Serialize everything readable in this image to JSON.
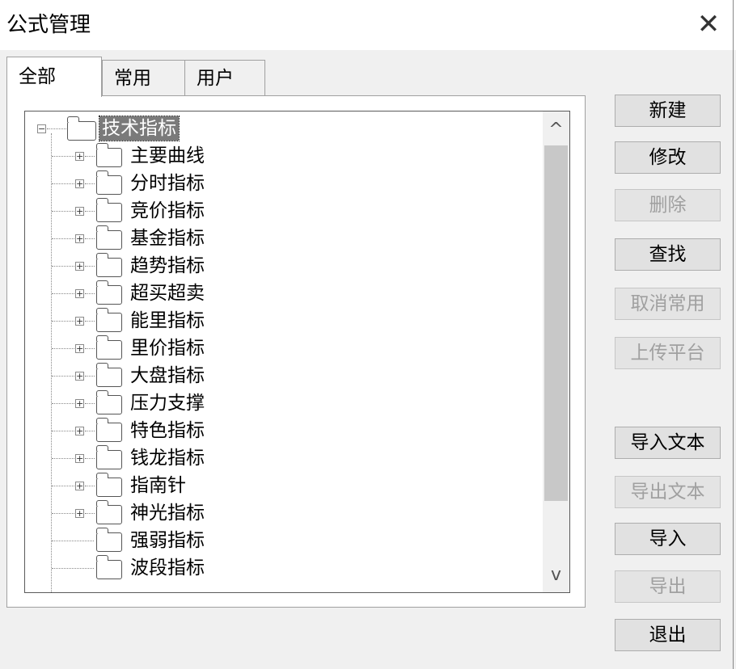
{
  "window": {
    "title": "公式管理",
    "close_label": "✕"
  },
  "tabs": [
    {
      "label": "全部",
      "active": true
    },
    {
      "label": "常用",
      "active": false
    },
    {
      "label": "用户",
      "active": false
    }
  ],
  "tree": {
    "root": {
      "label": "技术指标",
      "expander": "−"
    },
    "children": [
      {
        "label": "主要曲线",
        "expander": "+"
      },
      {
        "label": "分时指标",
        "expander": "+"
      },
      {
        "label": "竞价指标",
        "expander": "+"
      },
      {
        "label": "基金指标",
        "expander": "+"
      },
      {
        "label": "趋势指标",
        "expander": "+"
      },
      {
        "label": "超买超卖",
        "expander": "+"
      },
      {
        "label": "能里指标",
        "expander": "+"
      },
      {
        "label": "里价指标",
        "expander": "+"
      },
      {
        "label": "大盘指标",
        "expander": "+"
      },
      {
        "label": "压力支撑",
        "expander": "+"
      },
      {
        "label": "特色指标",
        "expander": "+"
      },
      {
        "label": "钱龙指标",
        "expander": "+"
      },
      {
        "label": "指南针",
        "expander": "+"
      },
      {
        "label": "神光指标",
        "expander": "+"
      },
      {
        "label": "强弱指标",
        "expander": ""
      },
      {
        "label": "波段指标",
        "expander": ""
      }
    ]
  },
  "scrollbar": {
    "up_arrow": "^",
    "down_arrow": "v"
  },
  "buttons": [
    {
      "label": "新建",
      "enabled": true
    },
    {
      "label": "修改",
      "enabled": true
    },
    {
      "label": "删除",
      "enabled": false
    },
    {
      "label": "查找",
      "enabled": true
    },
    {
      "label": "取消常用",
      "enabled": false
    },
    {
      "label": "上传平台",
      "enabled": false
    },
    {
      "label": "导入文本",
      "enabled": true
    },
    {
      "label": "导出文本",
      "enabled": false
    },
    {
      "label": "导入",
      "enabled": true
    },
    {
      "label": "导出",
      "enabled": false
    },
    {
      "label": "退出",
      "enabled": true
    }
  ],
  "colors": {
    "selection": "#7a7a7a",
    "disabled_text": "#a0a0a0"
  }
}
